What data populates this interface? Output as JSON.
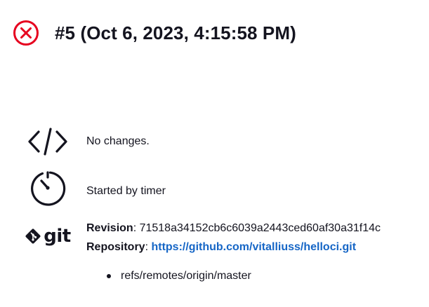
{
  "header": {
    "status_icon": "failed-circle-x-icon",
    "status_color": "#e6001f",
    "title": "#5 (Oct 6, 2023, 4:15:58 PM)"
  },
  "changes": {
    "icon": "code-brackets-icon",
    "text": "No changes."
  },
  "trigger": {
    "icon": "timer-icon",
    "text": "Started by timer"
  },
  "git": {
    "icon": "git-logo-icon",
    "logo_text": "git",
    "revision_label": "Revision",
    "revision_value": "71518a34152cb6c6039a2443ced60af30a31f14c",
    "repository_label": "Repository",
    "repository_url": "https://github.com/vitalliuss/helloci.git",
    "link_color": "#1666c6",
    "branches": [
      "refs/remotes/origin/master"
    ]
  }
}
